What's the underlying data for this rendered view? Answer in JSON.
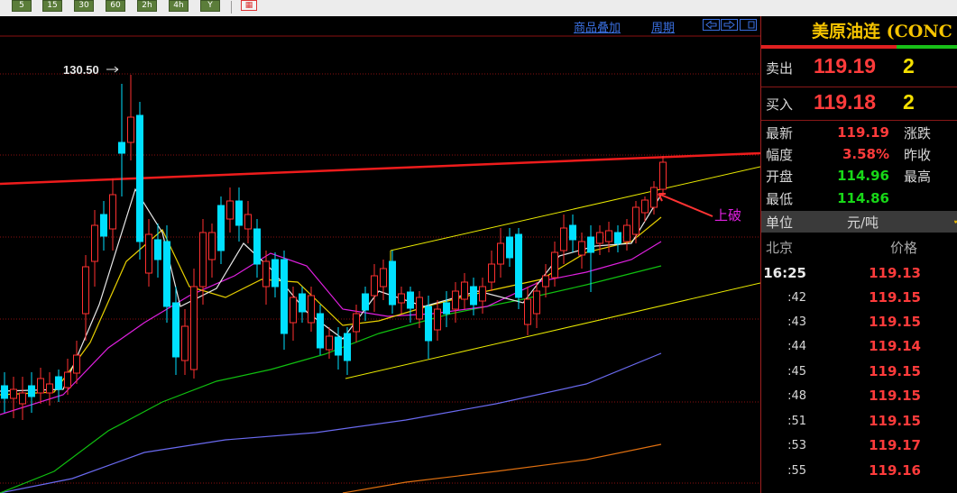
{
  "toolbar": {
    "buttons": [
      "5",
      "15",
      "30",
      "60",
      "2h",
      "4h",
      "Y"
    ],
    "red_button": "▦"
  },
  "chart": {
    "links": [
      "商品叠加",
      "周期"
    ],
    "nav_icons": [
      "arrow-left-box-icon",
      "arrow-right-box-icon",
      "window-box-icon"
    ],
    "high_label": "130.50",
    "annotation": "上破",
    "colors": {
      "bull": "#ff3030",
      "bear": "#00e0ff",
      "ma5": "#e8e8e8",
      "ma10": "#e8d000",
      "ma20": "#e020e0",
      "ma60": "#10c010",
      "ma120": "#6a6af0",
      "ma250": "#e07010",
      "resistance": "#ee1c1c",
      "channel": "#e8e800",
      "grid": "#8a1010"
    }
  },
  "panel": {
    "title": "美原油连 (CONC",
    "sell_label": "卖出",
    "sell_price": "119.19",
    "sell_qty": "2",
    "buy_label": "买入",
    "buy_price": "119.18",
    "buy_qty": "2",
    "quote": {
      "latest_label": "最新",
      "latest": "119.19",
      "change_label": "涨跌",
      "range_label": "幅度",
      "range": "3.58%",
      "prev_label": "昨收",
      "open_label": "开盘",
      "open": "114.96",
      "high_label": "最高",
      "low_label": "最低",
      "low": "114.86"
    },
    "unit_label": "单位",
    "unit_value": "元/吨",
    "tick_header_city": "北京",
    "tick_header_price": "价格",
    "ticks": [
      {
        "time": "16:25",
        "price": "119.13"
      },
      {
        "time": ":42",
        "price": "119.15"
      },
      {
        "time": ":43",
        "price": "119.15"
      },
      {
        "time": ":44",
        "price": "119.14"
      },
      {
        "time": ":45",
        "price": "119.15"
      },
      {
        "time": ":48",
        "price": "119.15"
      },
      {
        "time": ":51",
        "price": "119.15"
      },
      {
        "time": ":53",
        "price": "119.17"
      },
      {
        "time": ":55",
        "price": "119.16"
      }
    ]
  }
}
